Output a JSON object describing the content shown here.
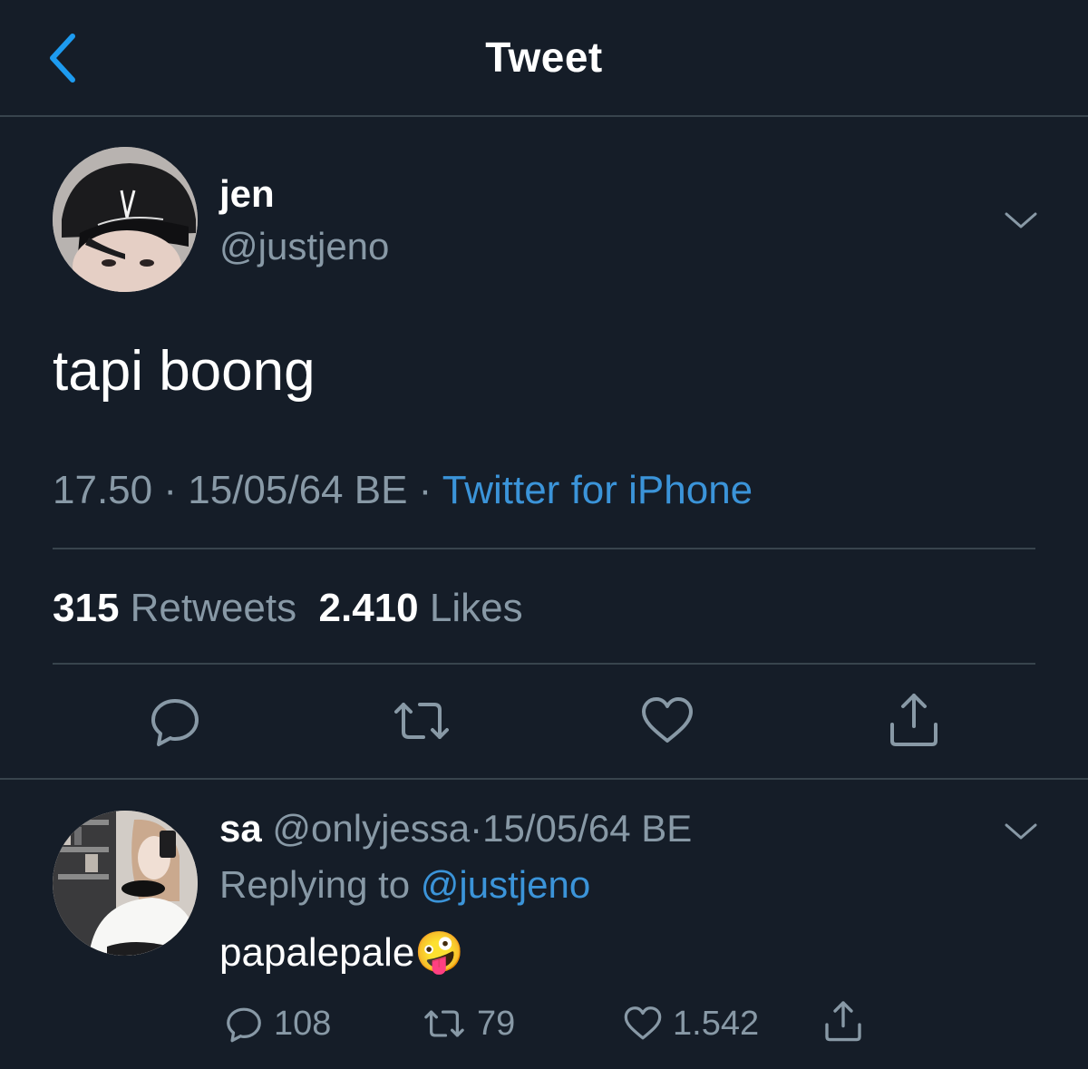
{
  "header": {
    "title": "Tweet"
  },
  "tweet": {
    "name": "jen",
    "handle": "@justjeno",
    "text": "tapi boong",
    "time": "17.50",
    "date": "15/05/64 BE",
    "source": "Twitter for iPhone",
    "sep": "·",
    "retweet_count": "315",
    "retweet_label": "Retweets",
    "like_count": "2.410",
    "like_label": "Likes"
  },
  "reply": {
    "name": "sa",
    "handle": "@onlyjessa",
    "sep": "·",
    "date": "15/05/64 BE",
    "replying_label": "Replying to",
    "replying_to": "@justjeno",
    "text": "papalepale",
    "emoji": "🤪",
    "reply_count": "108",
    "retweet_count": "79",
    "like_count": "1.542"
  },
  "colors": {
    "background": "#151d28",
    "accent": "#3b94d9",
    "muted": "#8899a6",
    "divider": "#38444d"
  }
}
